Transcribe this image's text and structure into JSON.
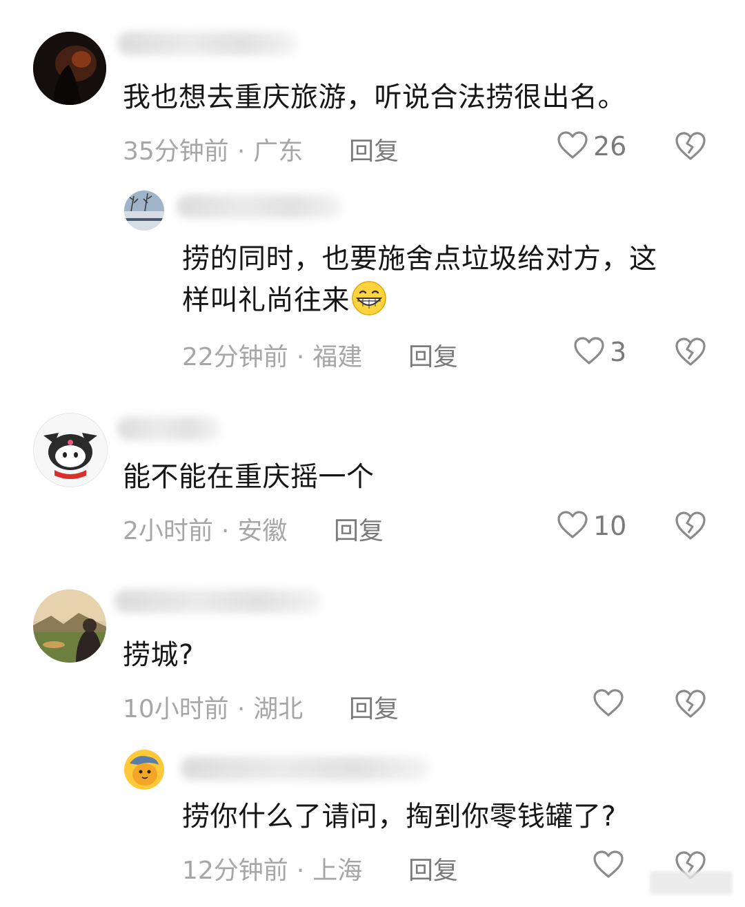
{
  "comments": [
    {
      "text": "我也想去重庆旅游，听说合法捞很出名。",
      "time": "35分钟前",
      "location": "广东",
      "reply_label": "回复",
      "likes": "26"
    },
    {
      "text_line1": "捞的同时，也要施舍点垃圾给对方，这",
      "text_line2": "样叫礼尚往来",
      "emoji": "grinning-face-emoji",
      "time": "22分钟前",
      "location": "福建",
      "reply_label": "回复",
      "likes": "3"
    },
    {
      "text": "能不能在重庆摇一个",
      "time": "2小时前",
      "location": "安徽",
      "reply_label": "回复",
      "likes": "10"
    },
    {
      "text": "捞城?",
      "time": "10小时前",
      "location": "湖北",
      "reply_label": "回复",
      "likes": ""
    },
    {
      "text": "捞你什么了请问，掏到你零钱罐了?",
      "time": "12分钟前",
      "location": "上海",
      "reply_label": "回复",
      "likes": ""
    }
  ],
  "separator": "·",
  "icons": {
    "like": "heart-outline-icon",
    "dislike": "broken-heart-icon"
  },
  "colors": {
    "meta_text": "#a6a6a6",
    "action_text": "#7a7a7a",
    "body_text": "#161616"
  }
}
